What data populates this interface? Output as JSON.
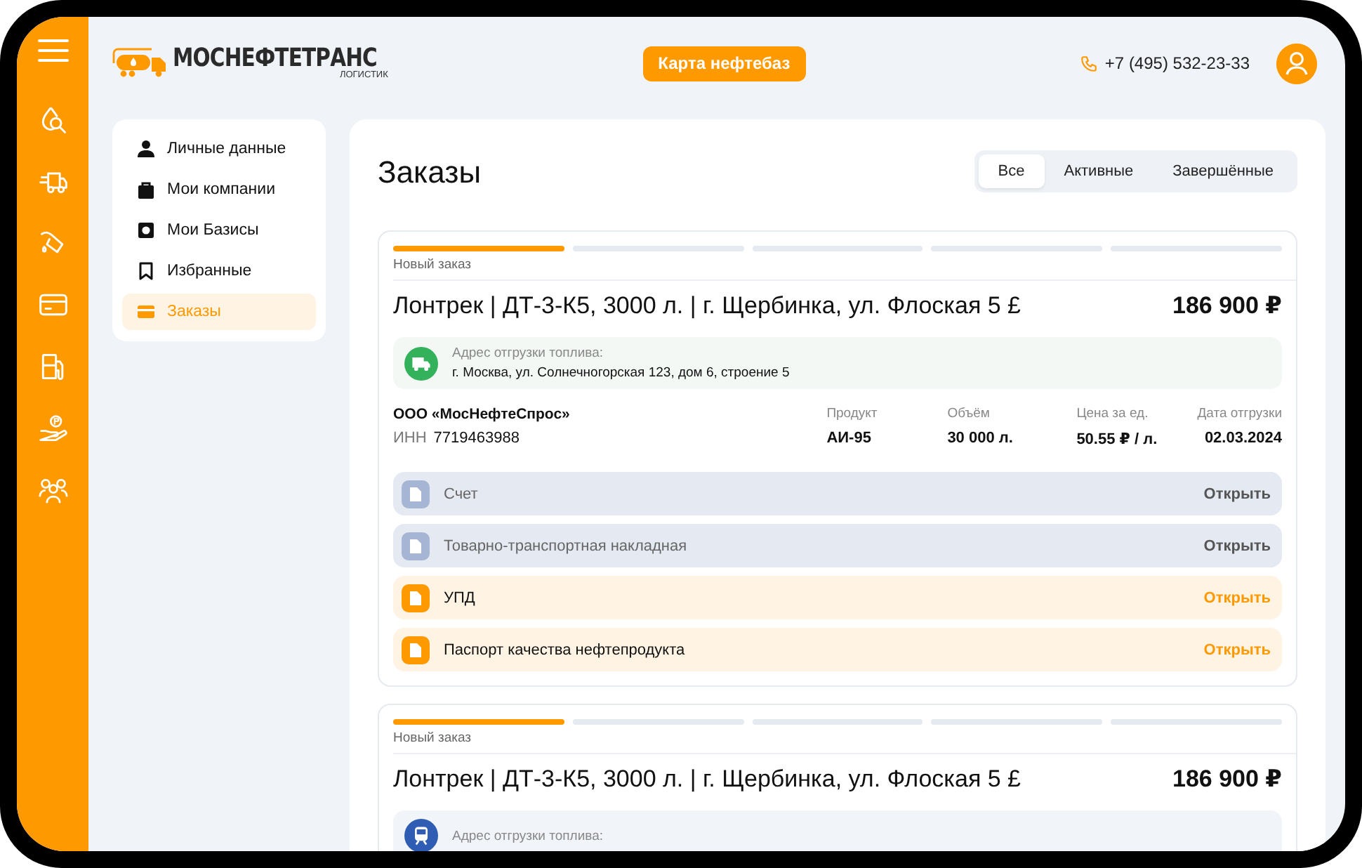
{
  "header": {
    "logo_name": "МОСНЕФТЕТРАНС",
    "logo_tagline": "ЛОГИСТИК",
    "map_button": "Карта нефтебаз",
    "phone": "+7 (495) 532-23-33"
  },
  "profile_menu": [
    {
      "label": "Личные данные",
      "selected": false
    },
    {
      "label": "Мои компании",
      "selected": false
    },
    {
      "label": "Мои Базисы",
      "selected": false
    },
    {
      "label": "Избранные",
      "selected": false
    },
    {
      "label": "Заказы",
      "selected": true
    }
  ],
  "orders_panel": {
    "title": "Заказы",
    "filter_tabs": [
      {
        "label": "Все",
        "selected": true
      },
      {
        "label": "Активные",
        "selected": false
      },
      {
        "label": "Завершённые",
        "selected": false
      }
    ],
    "orders": [
      {
        "steps": [
          {
            "done": true
          },
          {
            "done": false
          },
          {
            "done": false
          },
          {
            "done": false
          },
          {
            "done": false
          }
        ],
        "status": "Новый заказ",
        "title": "Лонтрек | ДТ-3-К5, 3000 л. | г. Щербинка, ул. Флоская 5 £",
        "total": "186 900 ₽",
        "shipping": {
          "kind": "truck",
          "color": "#33b25b",
          "label": "Адрес отгрузки топлива:",
          "address": "г. Москва, ул. Солнечногорская 123, дом 6, строение 5"
        },
        "company": {
          "name": "ООО «МосНефтеСпрос»",
          "inn_label": "ИНН",
          "inn": "7719463988"
        },
        "details": [
          {
            "label": "Продукт",
            "value": "АИ-95"
          },
          {
            "label": "Объём",
            "value": "30 000 л."
          },
          {
            "label": "Цена за ед.",
            "value": "50.55 ₽ / л."
          },
          {
            "label": "Дата отгрузки",
            "value": "02.03.2024"
          }
        ],
        "documents": [
          {
            "name": "Счет",
            "available": false,
            "action": "Открыть"
          },
          {
            "name": "Товарно-транспортная накладная",
            "available": false,
            "action": "Открыть"
          },
          {
            "name": "УПД",
            "available": true,
            "action": "Открыть"
          },
          {
            "name": "Паспорт качества нефтепродукта",
            "available": true,
            "action": "Открыть"
          }
        ]
      },
      {
        "steps": [
          {
            "done": true
          },
          {
            "done": false
          },
          {
            "done": false
          },
          {
            "done": false
          },
          {
            "done": false
          }
        ],
        "status": "Новый заказ",
        "title": "Лонтрек | ДТ-3-К5, 3000 л. | г. Щербинка, ул. Флоская 5 £",
        "total": "186 900 ₽",
        "shipping": {
          "kind": "train",
          "color": "#2f5db3",
          "label": "Адрес отгрузки топлива:"
        }
      }
    ]
  }
}
